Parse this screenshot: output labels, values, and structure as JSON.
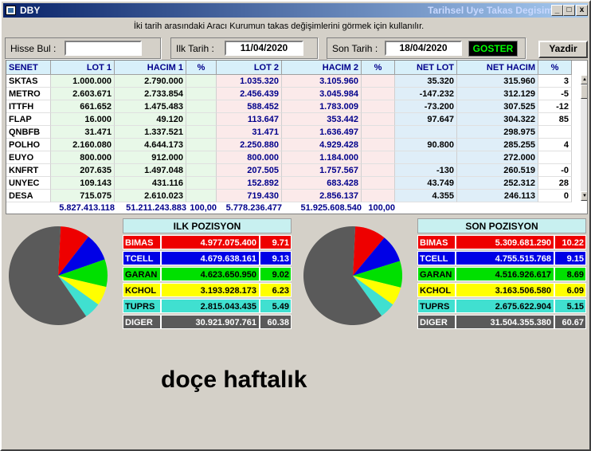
{
  "window": {
    "app_title": "DBY",
    "caption": "Tarihsel Uye Takas Degisim",
    "min_label": "_",
    "max_label": "□",
    "close_label": "x"
  },
  "description": "İki tarih arasındaki  Aracı Kurumun takas değişimlerini görmek için kullanılır.",
  "toolbar": {
    "hisse_label": "Hisse Bul :",
    "hisse_value": "",
    "ilk_label": "Ilk Tarih :",
    "ilk_value": "11/04/2020",
    "son_label": "Son Tarih :",
    "son_value": "18/04/2020",
    "goster_label": "GOSTER",
    "yazdir_label": "Yazdir"
  },
  "table": {
    "columns": [
      "SENET",
      "LOT 1",
      "HACIM 1",
      "%",
      "LOT 2",
      "HACIM 2",
      "%",
      "NET LOT",
      "NET HACIM",
      "%"
    ],
    "rows": [
      [
        "SKTAS",
        "1.000.000",
        "2.790.000",
        "",
        "1.035.320",
        "3.105.960",
        "",
        "35.320",
        "315.960",
        "3"
      ],
      [
        "METRO",
        "2.603.671",
        "2.733.854",
        "",
        "2.456.439",
        "3.045.984",
        "",
        "-147.232",
        "312.129",
        "-5"
      ],
      [
        "ITTFH",
        "661.652",
        "1.475.483",
        "",
        "588.452",
        "1.783.009",
        "",
        "-73.200",
        "307.525",
        "-12"
      ],
      [
        "FLAP",
        "16.000",
        "49.120",
        "",
        "113.647",
        "353.442",
        "",
        "97.647",
        "304.322",
        "85"
      ],
      [
        "QNBFB",
        "31.471",
        "1.337.521",
        "",
        "31.471",
        "1.636.497",
        "",
        "",
        "298.975",
        ""
      ],
      [
        "POLHO",
        "2.160.080",
        "4.644.173",
        "",
        "2.250.880",
        "4.929.428",
        "",
        "90.800",
        "285.255",
        "4"
      ],
      [
        "EUYO",
        "800.000",
        "912.000",
        "",
        "800.000",
        "1.184.000",
        "",
        "",
        "272.000",
        ""
      ],
      [
        "KNFRT",
        "207.635",
        "1.497.048",
        "",
        "207.505",
        "1.757.567",
        "",
        "-130",
        "260.519",
        "-0"
      ],
      [
        "UNYEC",
        "109.143",
        "431.116",
        "",
        "152.892",
        "683.428",
        "",
        "43.749",
        "252.312",
        "28"
      ],
      [
        "DESA",
        "715.075",
        "2.610.023",
        "",
        "719.430",
        "2.856.137",
        "",
        "4.355",
        "246.113",
        "0"
      ]
    ],
    "totals": {
      "lot1": "5.827.413.118",
      "hacim1": "51.211.243.883",
      "pct1": "100,00",
      "lot2": "5.778.236.477",
      "hacim2": "51.925.608.540",
      "pct2": "100,00"
    }
  },
  "ilk_pozisyon": {
    "title": "ILK POZISYON",
    "rows": [
      {
        "name": "BIMAS",
        "value": "4.977.075.400",
        "pct": "9.71",
        "pct_num": 9.71,
        "color": "#ee0000",
        "text": "#ffffff"
      },
      {
        "name": "TCELL",
        "value": "4.679.638.161",
        "pct": "9.13",
        "pct_num": 9.13,
        "color": "#0000e6",
        "text": "#ffffff"
      },
      {
        "name": "GARAN",
        "value": "4.623.650.950",
        "pct": "9.02",
        "pct_num": 9.02,
        "color": "#00e000",
        "text": "#000000"
      },
      {
        "name": "KCHOL",
        "value": "3.193.928.173",
        "pct": "6.23",
        "pct_num": 6.23,
        "color": "#ffff00",
        "text": "#000000"
      },
      {
        "name": "TUPRS",
        "value": "2.815.043.435",
        "pct": "5.49",
        "pct_num": 5.49,
        "color": "#40e0d0",
        "text": "#000000"
      },
      {
        "name": "DIGER",
        "value": "30.921.907.761",
        "pct": "60.38",
        "pct_num": 60.38,
        "color": "#5a5a5a",
        "text": "#ffffff"
      }
    ]
  },
  "son_pozisyon": {
    "title": "SON POZISYON",
    "rows": [
      {
        "name": "BIMAS",
        "value": "5.309.681.290",
        "pct": "10.22",
        "pct_num": 10.22,
        "color": "#ee0000",
        "text": "#ffffff"
      },
      {
        "name": "TCELL",
        "value": "4.755.515.768",
        "pct": "9.15",
        "pct_num": 9.15,
        "color": "#0000e6",
        "text": "#ffffff"
      },
      {
        "name": "GARAN",
        "value": "4.516.926.617",
        "pct": "8.69",
        "pct_num": 8.69,
        "color": "#00e000",
        "text": "#000000"
      },
      {
        "name": "KCHOL",
        "value": "3.163.506.580",
        "pct": "6.09",
        "pct_num": 6.09,
        "color": "#ffff00",
        "text": "#000000"
      },
      {
        "name": "TUPRS",
        "value": "2.675.622.904",
        "pct": "5.15",
        "pct_num": 5.15,
        "color": "#40e0d0",
        "text": "#000000"
      },
      {
        "name": "DIGER",
        "value": "31.504.355.380",
        "pct": "60.67",
        "pct_num": 60.67,
        "color": "#5a5a5a",
        "text": "#ffffff"
      }
    ]
  },
  "footer_text": "doçe haftalık"
}
